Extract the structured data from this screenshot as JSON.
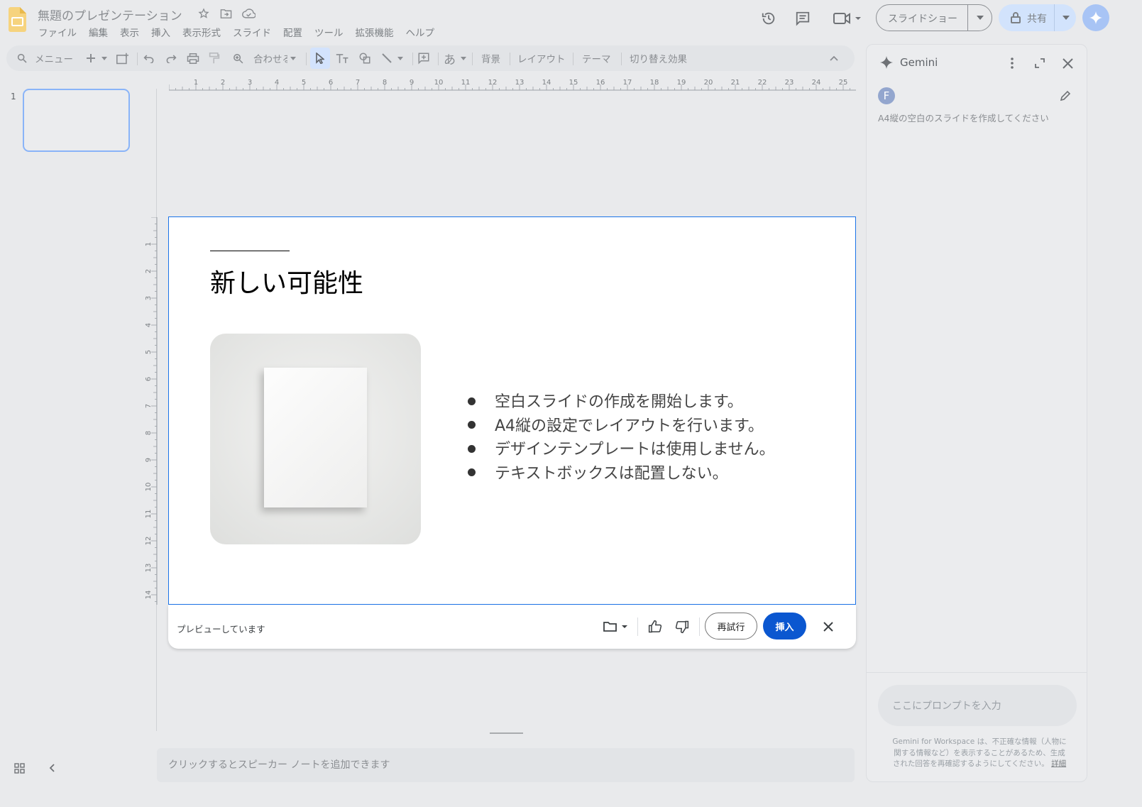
{
  "app": {
    "title": "無題のプレゼンテーション",
    "menus": [
      "ファイル",
      "編集",
      "表示",
      "挿入",
      "表示形式",
      "スライド",
      "配置",
      "ツール",
      "拡張機能",
      "ヘルプ"
    ]
  },
  "header": {
    "slideshow_label": "スライドショー",
    "share_label": "共有"
  },
  "toolbar": {
    "menu_search": "メニュー",
    "zoom_label": "合わせる",
    "background": "背景",
    "layout": "レイアウト",
    "theme": "テーマ",
    "transition": "切り替え効果",
    "japanese_input": "あ"
  },
  "ruler": {
    "h_ticks": [
      "1",
      "2",
      "3",
      "4",
      "5",
      "6",
      "7",
      "8",
      "9",
      "10",
      "11",
      "12",
      "13",
      "14",
      "15",
      "16",
      "17",
      "18",
      "19",
      "20",
      "21",
      "22",
      "23",
      "24",
      "25"
    ],
    "v_ticks": [
      "1",
      "2",
      "3",
      "4",
      "5",
      "6",
      "7",
      "8",
      "9",
      "10",
      "11",
      "12",
      "13",
      "14"
    ]
  },
  "filmstrip": {
    "slide_number": "1"
  },
  "slide": {
    "title": "新しい可能性",
    "bullets": [
      "空白スライドの作成を開始します。",
      "A4縦の設定でレイアウトを行います。",
      "デザインテンプレートは使用しません。",
      "テキストボックスは配置しない。"
    ]
  },
  "preview": {
    "status": "プレビューしています",
    "retry_label": "再試行",
    "insert_label": "挿入"
  },
  "notes": {
    "placeholder": "クリックするとスピーカー ノートを追加できます"
  },
  "gemini": {
    "title": "Gemini",
    "user_initial": "F",
    "user_prompt": "A4縦の空白のスライドを作成してください",
    "input_placeholder": "ここにプロンプトを入力",
    "disclaimer_lines": [
      "Gemini for Workspace は、不正確な情報（人物に",
      "関する情報など）を表示することがあるため、生成",
      "された回答を再確認するようにしてください。"
    ],
    "details_link": "詳細"
  },
  "colors": {
    "accent": "#1a73e8",
    "insert_button": "#0b57d0",
    "slides_logo": "#f4b400"
  }
}
